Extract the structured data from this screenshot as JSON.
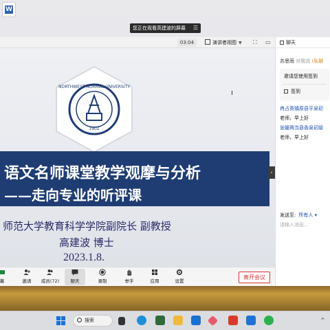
{
  "share_bar": {
    "text": "您正在观看高建波的屏幕",
    "icon": "grid-icon"
  },
  "topbar": {
    "timer": "03:04",
    "view_label": "演讲者视图",
    "chat_title": "聊天"
  },
  "slide": {
    "logo_text": "NORTHWEST NORMAL UNIVERSITY",
    "logo_year": "1902",
    "title_line1": "语文名师课堂教学观摩与分析",
    "title_line2": "——走向专业的听评课",
    "affiliation": "师范大学教育科学学院副院长  副教授",
    "presenter": "高建波  博士",
    "date": "2023.1.8."
  },
  "toolbar": {
    "items": [
      {
        "label": "幕",
        "icon": "screen-icon"
      },
      {
        "label": "邀请",
        "icon": "invite-icon"
      },
      {
        "label": "成员(72)",
        "icon": "members-icon"
      },
      {
        "label": "聊天",
        "icon": "chat-icon"
      },
      {
        "label": "录制",
        "icon": "record-icon"
      },
      {
        "label": "举手",
        "icon": "hand-icon"
      },
      {
        "label": "应用",
        "icon": "apps-icon"
      },
      {
        "label": "设置",
        "icon": "settings-icon"
      }
    ],
    "leave_label": "离开会议"
  },
  "chat": {
    "line1_name": "苏思雨",
    "line1_to": " 对我说",
    "line1_tag": " (私聊",
    "checkin_text": "邀请您使用签到",
    "checkin_label": "签到",
    "messages": [
      {
        "sender": "冉占英镇原县平泉初",
        "text": "老师，早上好"
      },
      {
        "sender": "张媛两当县香泉初级",
        "text": "老师，早上好"
      }
    ],
    "send_label": "发送至:",
    "send_target": "所有人 ▾",
    "input_placeholder": "请输入消息..."
  },
  "taskbar": {
    "search_label": "搜索",
    "tray_arrow": "^"
  },
  "colors": {
    "title_band": "#1f3d73",
    "accent_blue": "#1a4fb0",
    "leave_red": "#dd3333",
    "chat_name_orange": "#e08a1e"
  }
}
